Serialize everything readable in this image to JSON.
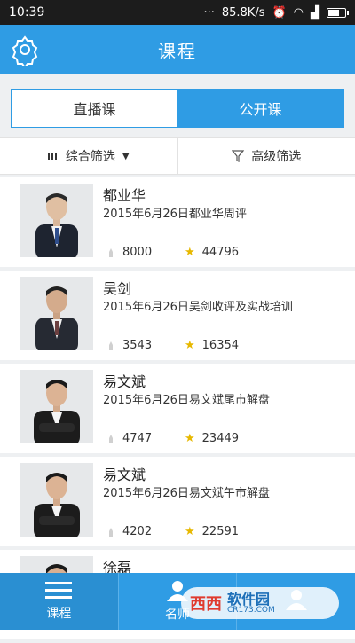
{
  "status_bar": {
    "time": "10:39",
    "speed": "85.8K/s"
  },
  "header": {
    "title": "课程"
  },
  "tabs": [
    {
      "label": "直播课",
      "active": false
    },
    {
      "label": "公开课",
      "active": true
    }
  ],
  "filters": [
    {
      "label": "综合筛选",
      "icon": "list-icon"
    },
    {
      "label": "高级筛选",
      "icon": "funnel-icon"
    }
  ],
  "courses": [
    {
      "name": "都业华",
      "desc": "2015年6月26日都业华周评",
      "likes": "8000",
      "stars": "44796"
    },
    {
      "name": "吴剑",
      "desc": "2015年6月26日吴剑收评及实战培训",
      "likes": "3543",
      "stars": "16354"
    },
    {
      "name": "易文斌",
      "desc": "2015年6月26日易文斌尾市解盘",
      "likes": "4747",
      "stars": "23449"
    },
    {
      "name": "易文斌",
      "desc": "2015年6月26日易文斌午市解盘",
      "likes": "4202",
      "stars": "22591"
    },
    {
      "name": "徐磊",
      "desc": "",
      "likes": "",
      "stars": ""
    }
  ],
  "bottom_nav": [
    {
      "label": "课程",
      "icon": "menu-icon",
      "active": true
    },
    {
      "label": "名师",
      "icon": "user-icon",
      "active": false
    },
    {
      "label": "",
      "icon": "user-icon",
      "active": false
    }
  ],
  "watermark": {
    "logo": "西西",
    "main": "软件园",
    "sub": "CR173.COM"
  },
  "colors": {
    "primary": "#2f9ce4",
    "star": "#e7b800"
  }
}
